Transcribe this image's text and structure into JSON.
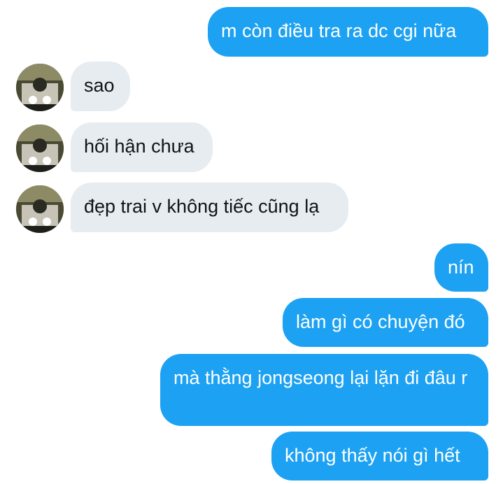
{
  "messages": [
    {
      "side": "outgoing",
      "text": "m còn điều tra ra dc cgi nữa"
    },
    {
      "side": "incoming",
      "text": "sao",
      "avatar_icon": "user-avatar"
    },
    {
      "side": "incoming",
      "text": "hối hận chưa",
      "avatar_icon": "user-avatar"
    },
    {
      "side": "incoming",
      "text": "đẹp trai v không tiếc cũng lạ",
      "avatar_icon": "user-avatar"
    },
    {
      "side": "outgoing",
      "text": "nín"
    },
    {
      "side": "outgoing",
      "text": "làm gì có chuyện đó"
    },
    {
      "side": "outgoing",
      "text": "mà thằng jongseong lại lặn đi đâu r"
    },
    {
      "side": "outgoing",
      "text": "không thấy nói gì hết"
    }
  ],
  "colors": {
    "incoming_bubble": "#e6ecf0",
    "outgoing_bubble": "#1da1f2",
    "incoming_text": "#101418",
    "outgoing_text": "#ffffff",
    "background": "#ffffff"
  }
}
